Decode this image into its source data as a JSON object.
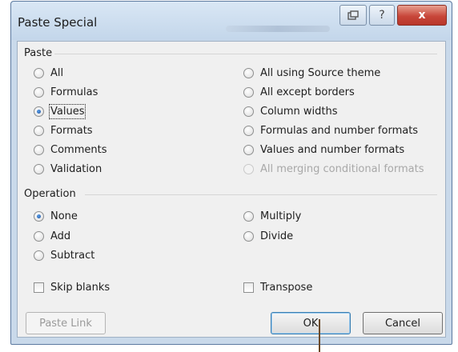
{
  "window": {
    "title": "Paste Special",
    "restore_icon": "restore-icon",
    "help_label": "?",
    "close_label": "x"
  },
  "paste_group": {
    "label": "Paste",
    "left_options": [
      {
        "label": "All",
        "checked": false
      },
      {
        "label": "Formulas",
        "checked": false
      },
      {
        "label": "Values",
        "checked": true
      },
      {
        "label": "Formats",
        "checked": false
      },
      {
        "label": "Comments",
        "checked": false
      },
      {
        "label": "Validation",
        "checked": false
      }
    ],
    "right_options": [
      {
        "label": "All using Source theme",
        "checked": false,
        "disabled": false
      },
      {
        "label": "All except borders",
        "checked": false,
        "disabled": false
      },
      {
        "label": "Column widths",
        "checked": false,
        "disabled": false
      },
      {
        "label": "Formulas and number formats",
        "checked": false,
        "disabled": false
      },
      {
        "label": "Values and number formats",
        "checked": false,
        "disabled": false
      },
      {
        "label": "All merging conditional formats",
        "checked": false,
        "disabled": true
      }
    ]
  },
  "operation_group": {
    "label": "Operation",
    "left_options": [
      {
        "label": "None",
        "checked": true
      },
      {
        "label": "Add",
        "checked": false
      },
      {
        "label": "Subtract",
        "checked": false
      }
    ],
    "right_options": [
      {
        "label": "Multiply",
        "checked": false
      },
      {
        "label": "Divide",
        "checked": false
      }
    ]
  },
  "checkboxes": {
    "skip_blanks": {
      "label": "Skip blanks",
      "checked": false
    },
    "transpose": {
      "label": "Transpose",
      "checked": false
    }
  },
  "buttons": {
    "paste_link": "Paste Link",
    "ok": "OK",
    "cancel": "Cancel"
  }
}
